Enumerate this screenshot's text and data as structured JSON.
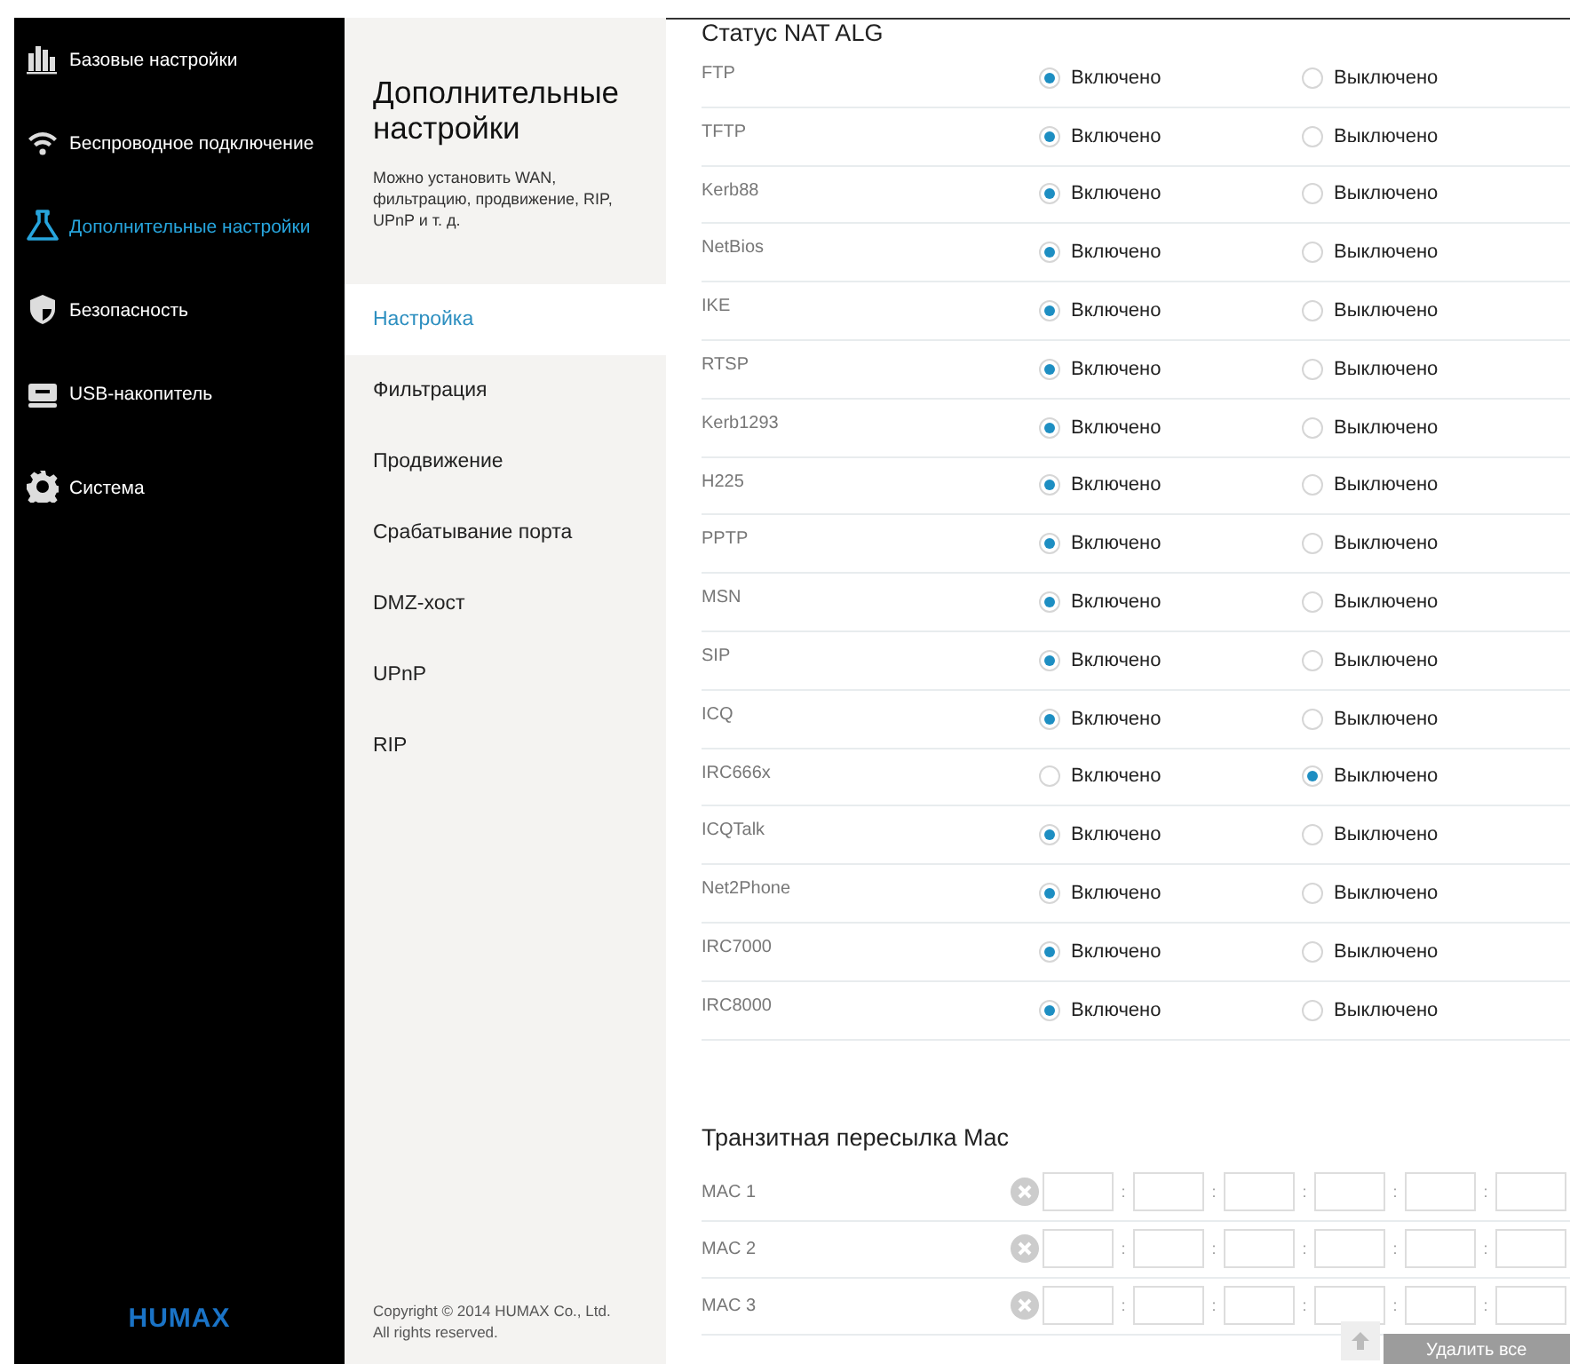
{
  "sidebar": {
    "items": [
      {
        "kind": "bars",
        "label": "Базовые настройки",
        "selected": false
      },
      {
        "kind": "wifi",
        "label": "Беспроводное подключение",
        "selected": false
      },
      {
        "kind": "flask",
        "label": "Дополнительные настройки",
        "selected": true
      },
      {
        "kind": "shield",
        "label": "Безопасность",
        "selected": false
      },
      {
        "kind": "usb",
        "label": "USB-накопитель",
        "selected": false
      },
      {
        "kind": "gear",
        "label": "Система",
        "selected": false
      }
    ],
    "logo": "HUMAX"
  },
  "submenu": {
    "title": "Дополнительные настройки",
    "description": "Можно установить WAN, фильтрацию, продвижение, RIP, UPnP и т. д.",
    "items": [
      {
        "label": "Настройка",
        "selected": true
      },
      {
        "label": "Фильтрация",
        "selected": false
      },
      {
        "label": "Продвижение",
        "selected": false
      },
      {
        "label": "Срабатывание порта",
        "selected": false
      },
      {
        "label": "DMZ-хост",
        "selected": false
      },
      {
        "label": "UPnP",
        "selected": false
      },
      {
        "label": "RIP",
        "selected": false
      }
    ],
    "copyright": "Copyright © 2014 HUMAX Co., Ltd.\nAll rights reserved."
  },
  "nat_alg": {
    "title": "Статус NAT ALG",
    "rows": [
      {
        "name": "FTP",
        "options": [
          {
            "label": "Включено",
            "selected": true
          },
          {
            "label": "Выключено",
            "selected": false
          }
        ]
      },
      {
        "name": "TFTP",
        "options": [
          {
            "label": "Включено",
            "selected": true
          },
          {
            "label": "Выключено",
            "selected": false
          }
        ]
      },
      {
        "name": "Kerb88",
        "options": [
          {
            "label": "Включено",
            "selected": true
          },
          {
            "label": "Выключено",
            "selected": false
          }
        ]
      },
      {
        "name": "NetBios",
        "options": [
          {
            "label": "Включено",
            "selected": true
          },
          {
            "label": "Выключено",
            "selected": false
          }
        ]
      },
      {
        "name": "IKE",
        "options": [
          {
            "label": "Включено",
            "selected": true
          },
          {
            "label": "Выключено",
            "selected": false
          }
        ]
      },
      {
        "name": "RTSP",
        "options": [
          {
            "label": "Включено",
            "selected": true
          },
          {
            "label": "Выключено",
            "selected": false
          }
        ]
      },
      {
        "name": "Kerb1293",
        "options": [
          {
            "label": "Включено",
            "selected": true
          },
          {
            "label": "Выключено",
            "selected": false
          }
        ]
      },
      {
        "name": "H225",
        "options": [
          {
            "label": "Включено",
            "selected": true
          },
          {
            "label": "Выключено",
            "selected": false
          }
        ]
      },
      {
        "name": "PPTP",
        "options": [
          {
            "label": "Включено",
            "selected": true
          },
          {
            "label": "Выключено",
            "selected": false
          }
        ]
      },
      {
        "name": "MSN",
        "options": [
          {
            "label": "Включено",
            "selected": true
          },
          {
            "label": "Выключено",
            "selected": false
          }
        ]
      },
      {
        "name": "SIP",
        "options": [
          {
            "label": "Включено",
            "selected": true
          },
          {
            "label": "Выключено",
            "selected": false
          }
        ]
      },
      {
        "name": "ICQ",
        "options": [
          {
            "label": "Включено",
            "selected": true
          },
          {
            "label": "Выключено",
            "selected": false
          }
        ]
      },
      {
        "name": "IRC666x",
        "options": [
          {
            "label": "Включено",
            "selected": false
          },
          {
            "label": "Выключено",
            "selected": true
          }
        ]
      },
      {
        "name": "ICQTalk",
        "options": [
          {
            "label": "Включено",
            "selected": true
          },
          {
            "label": "Выключено",
            "selected": false
          }
        ]
      },
      {
        "name": "Net2Phone",
        "options": [
          {
            "label": "Включено",
            "selected": true
          },
          {
            "label": "Выключено",
            "selected": false
          }
        ]
      },
      {
        "name": "IRC7000",
        "options": [
          {
            "label": "Включено",
            "selected": true
          },
          {
            "label": "Выключено",
            "selected": false
          }
        ]
      },
      {
        "name": "IRC8000",
        "options": [
          {
            "label": "Включено",
            "selected": true
          },
          {
            "label": "Выключено",
            "selected": false
          }
        ]
      }
    ]
  },
  "mac_passthrough": {
    "title": "Транзитная пересылка Mac",
    "separator": ":",
    "rows": [
      {
        "label": "MAC 1"
      },
      {
        "label": "MAC 2"
      },
      {
        "label": "MAC 3"
      }
    ],
    "delete_all_button": "Удалить все"
  }
}
